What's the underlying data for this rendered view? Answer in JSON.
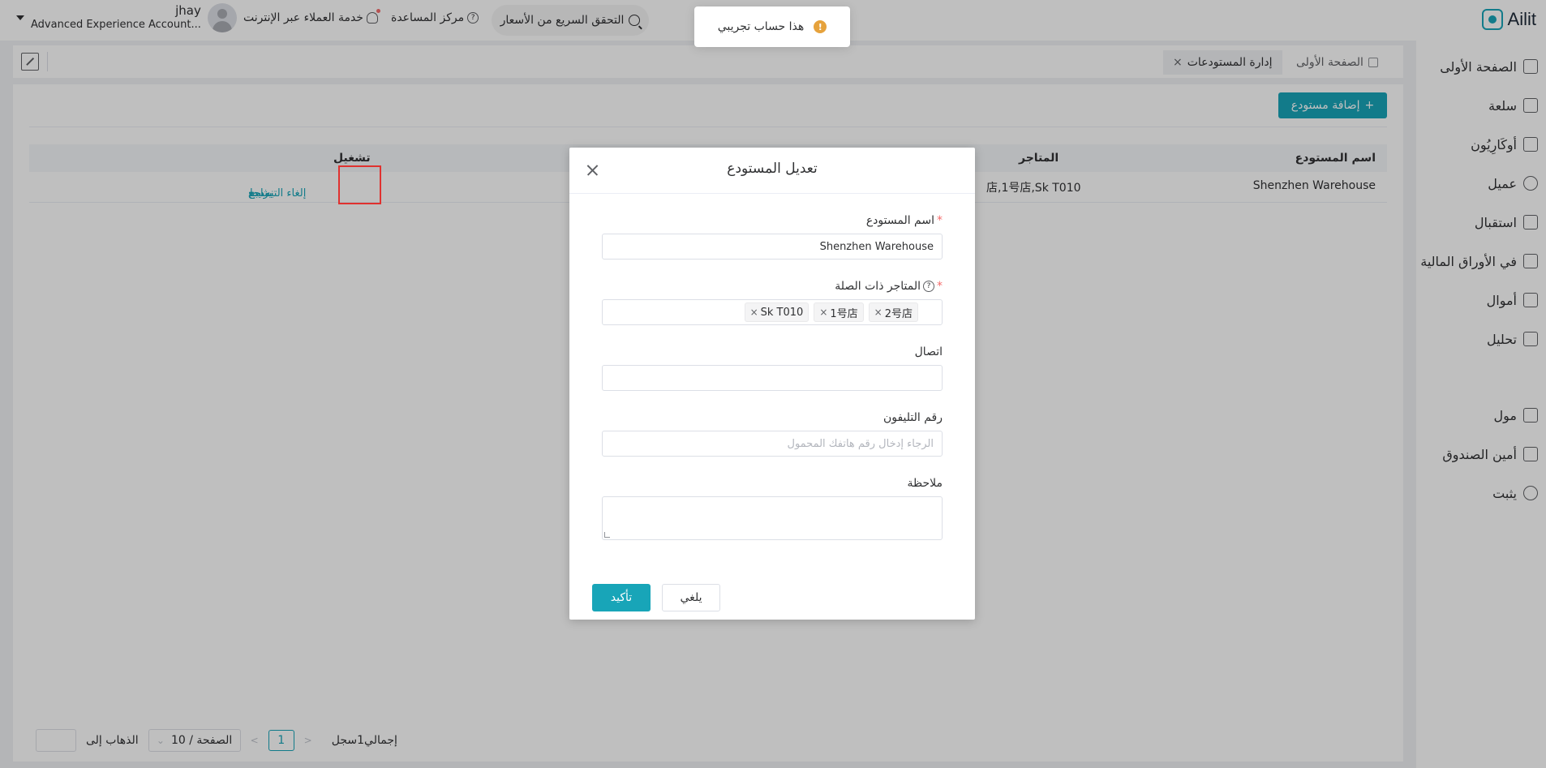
{
  "app": {
    "logo_text": "Ailit"
  },
  "header": {
    "user_name": "jhay",
    "user_account": "Advanced Experience Account...",
    "online_service": "خدمة العملاء عبر الإنترنت",
    "help_center": "مركز المساعدة",
    "price_check": "التحقق السريع من الأسعار"
  },
  "toast": {
    "message": "هذا حساب تجريبي"
  },
  "sidebar": {
    "items": [
      {
        "label": "الصفحة الأولى",
        "icon": "home-icon"
      },
      {
        "label": "سلعة",
        "icon": "bag-icon"
      },
      {
        "label": "أوكَارِيُون",
        "icon": "clipboard-icon"
      },
      {
        "label": "عميل",
        "icon": "user-icon"
      },
      {
        "label": "استقبال",
        "icon": "book-icon"
      },
      {
        "label": "في الأوراق المالية",
        "icon": "warehouse-icon"
      },
      {
        "label": "أموال",
        "icon": "wallet-icon"
      },
      {
        "label": "تحليل",
        "icon": "chart-icon"
      },
      {
        "label": "مول",
        "icon": "store-icon"
      },
      {
        "label": "أمين الصندوق",
        "icon": "monitor-icon"
      },
      {
        "label": "يثبت",
        "icon": "gear-icon"
      }
    ]
  },
  "tabs": [
    {
      "label": "الصفحة الأولى"
    },
    {
      "label": "إدارة المستودعات",
      "close": "×"
    }
  ],
  "page": {
    "add_button": "إضافة مستودع",
    "add_icon": "+",
    "table": {
      "columns": {
        "name": "اسم المستودع",
        "stores": "المتاجر",
        "operation": "تشغيل"
      },
      "row": {
        "name": "Shenzhen Warehouse",
        "stores": "店,1号店,Sk T010",
        "actions": {
          "review": "يراجع",
          "delete": "يمسح",
          "deactivate": "إلغاء التنشيط"
        }
      }
    },
    "pagination": {
      "total": "إجمالي1سجل",
      "page": "1",
      "page_size": "10 / الصفحة",
      "goto": "الذهاب إلى"
    }
  },
  "dialog": {
    "title": "تعديل المستودع",
    "fields": {
      "name": {
        "label": "اسم المستودع",
        "required": "*",
        "value": "Shenzhen Warehouse"
      },
      "stores": {
        "label": "المتاجر ذات الصلة",
        "required": "*",
        "tags": [
          "2号店",
          "1号店",
          "Sk T010"
        ]
      },
      "contact": {
        "label": "اتصال",
        "value": ""
      },
      "phone": {
        "label": "رقم التليفون",
        "placeholder": "الرجاء إدخال رقم هاتفك المحمول"
      },
      "note": {
        "label": "ملاحظة",
        "value": ""
      }
    },
    "cancel": "يلغي",
    "confirm": "تأكيد"
  },
  "colors": {
    "accent": "#18a5b8",
    "highlight_box": "#e0312f",
    "warning": "#e6a23c"
  }
}
